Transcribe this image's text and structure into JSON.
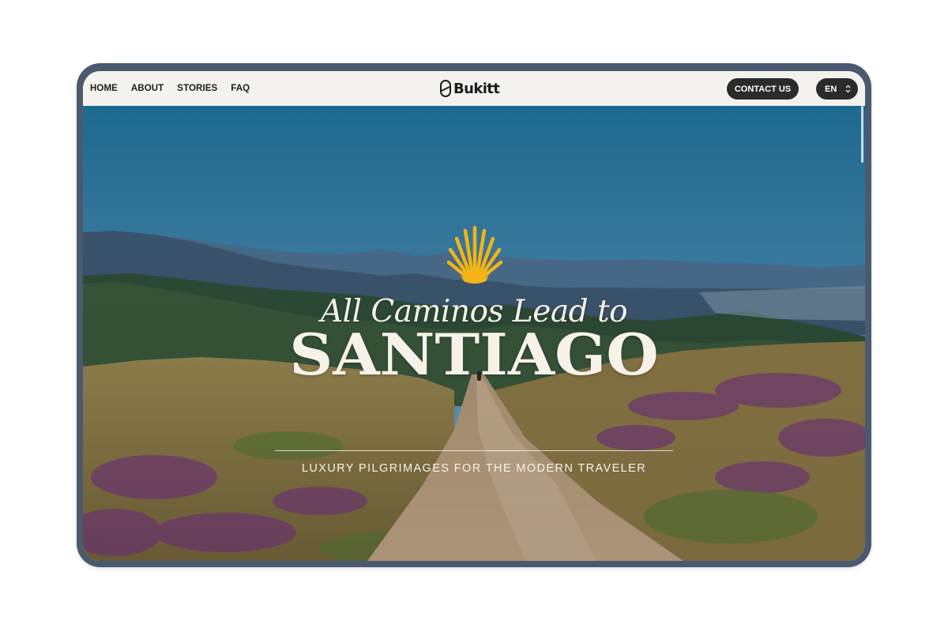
{
  "nav": {
    "links": [
      "HOME",
      "ABOUT",
      "STORIES",
      "FAQ"
    ],
    "brand": "Bukitt",
    "contact_label": "CONTACT US",
    "language": "EN"
  },
  "hero": {
    "script_heading": "All Caminos Lead to",
    "title": "SANTIAGO",
    "subtitle": "LUXURY PILGRIMAGES FOR THE MODERN TRAVELER",
    "background": "mountain landscape with dirt path and heather",
    "icon": "scallop-shell-icon"
  },
  "colors": {
    "nav_bg": "#f4f2ee",
    "button_dark": "#2b2b2b",
    "accent_gold": "#f2b416",
    "device_frame": "#4a5a6e",
    "hero_text": "#f6f2ea"
  }
}
